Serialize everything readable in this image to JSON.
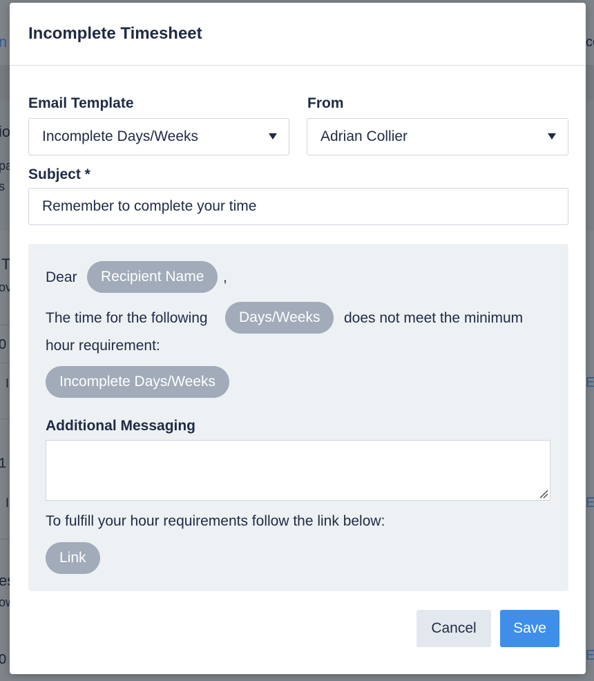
{
  "modal": {
    "title": "Incomplete Timesheet"
  },
  "form": {
    "email_template": {
      "label": "Email Template",
      "value": "Incomplete Days/Weeks"
    },
    "from": {
      "label": "From",
      "value": "Adrian Collier"
    },
    "subject": {
      "label": "Subject *",
      "value": "Remember to complete your time"
    }
  },
  "preview": {
    "greeting": "Dear",
    "recipient_tag": "Recipient Name",
    "greeting_comma": ",",
    "line1_prefix": "The time for the following",
    "days_weeks_tag": "Days/Weeks",
    "line1_suffix": "does not meet the minimum",
    "line2": "hour requirement:",
    "incomplete_tag": "Incomplete Days/Weeks",
    "additional_label": "Additional Messaging",
    "additional_value": "",
    "link_text_line": "To fulfill your hour requirements follow the link below:",
    "link_tag": "Link"
  },
  "footer": {
    "cancel_label": "Cancel",
    "save_label": "Save"
  },
  "background": {
    "fragments": [
      "n",
      "io",
      "pa",
      "s",
      "T",
      "ov",
      "0",
      "I",
      "1",
      "I",
      "es",
      "ow",
      "0",
      "ce",
      "Ed",
      "Ed",
      "Ed"
    ]
  },
  "colors": {
    "primary": "#3f8fea",
    "tag_bg": "#a1abb9",
    "preview_bg": "#edf1f4",
    "text": "#1f2a44"
  }
}
